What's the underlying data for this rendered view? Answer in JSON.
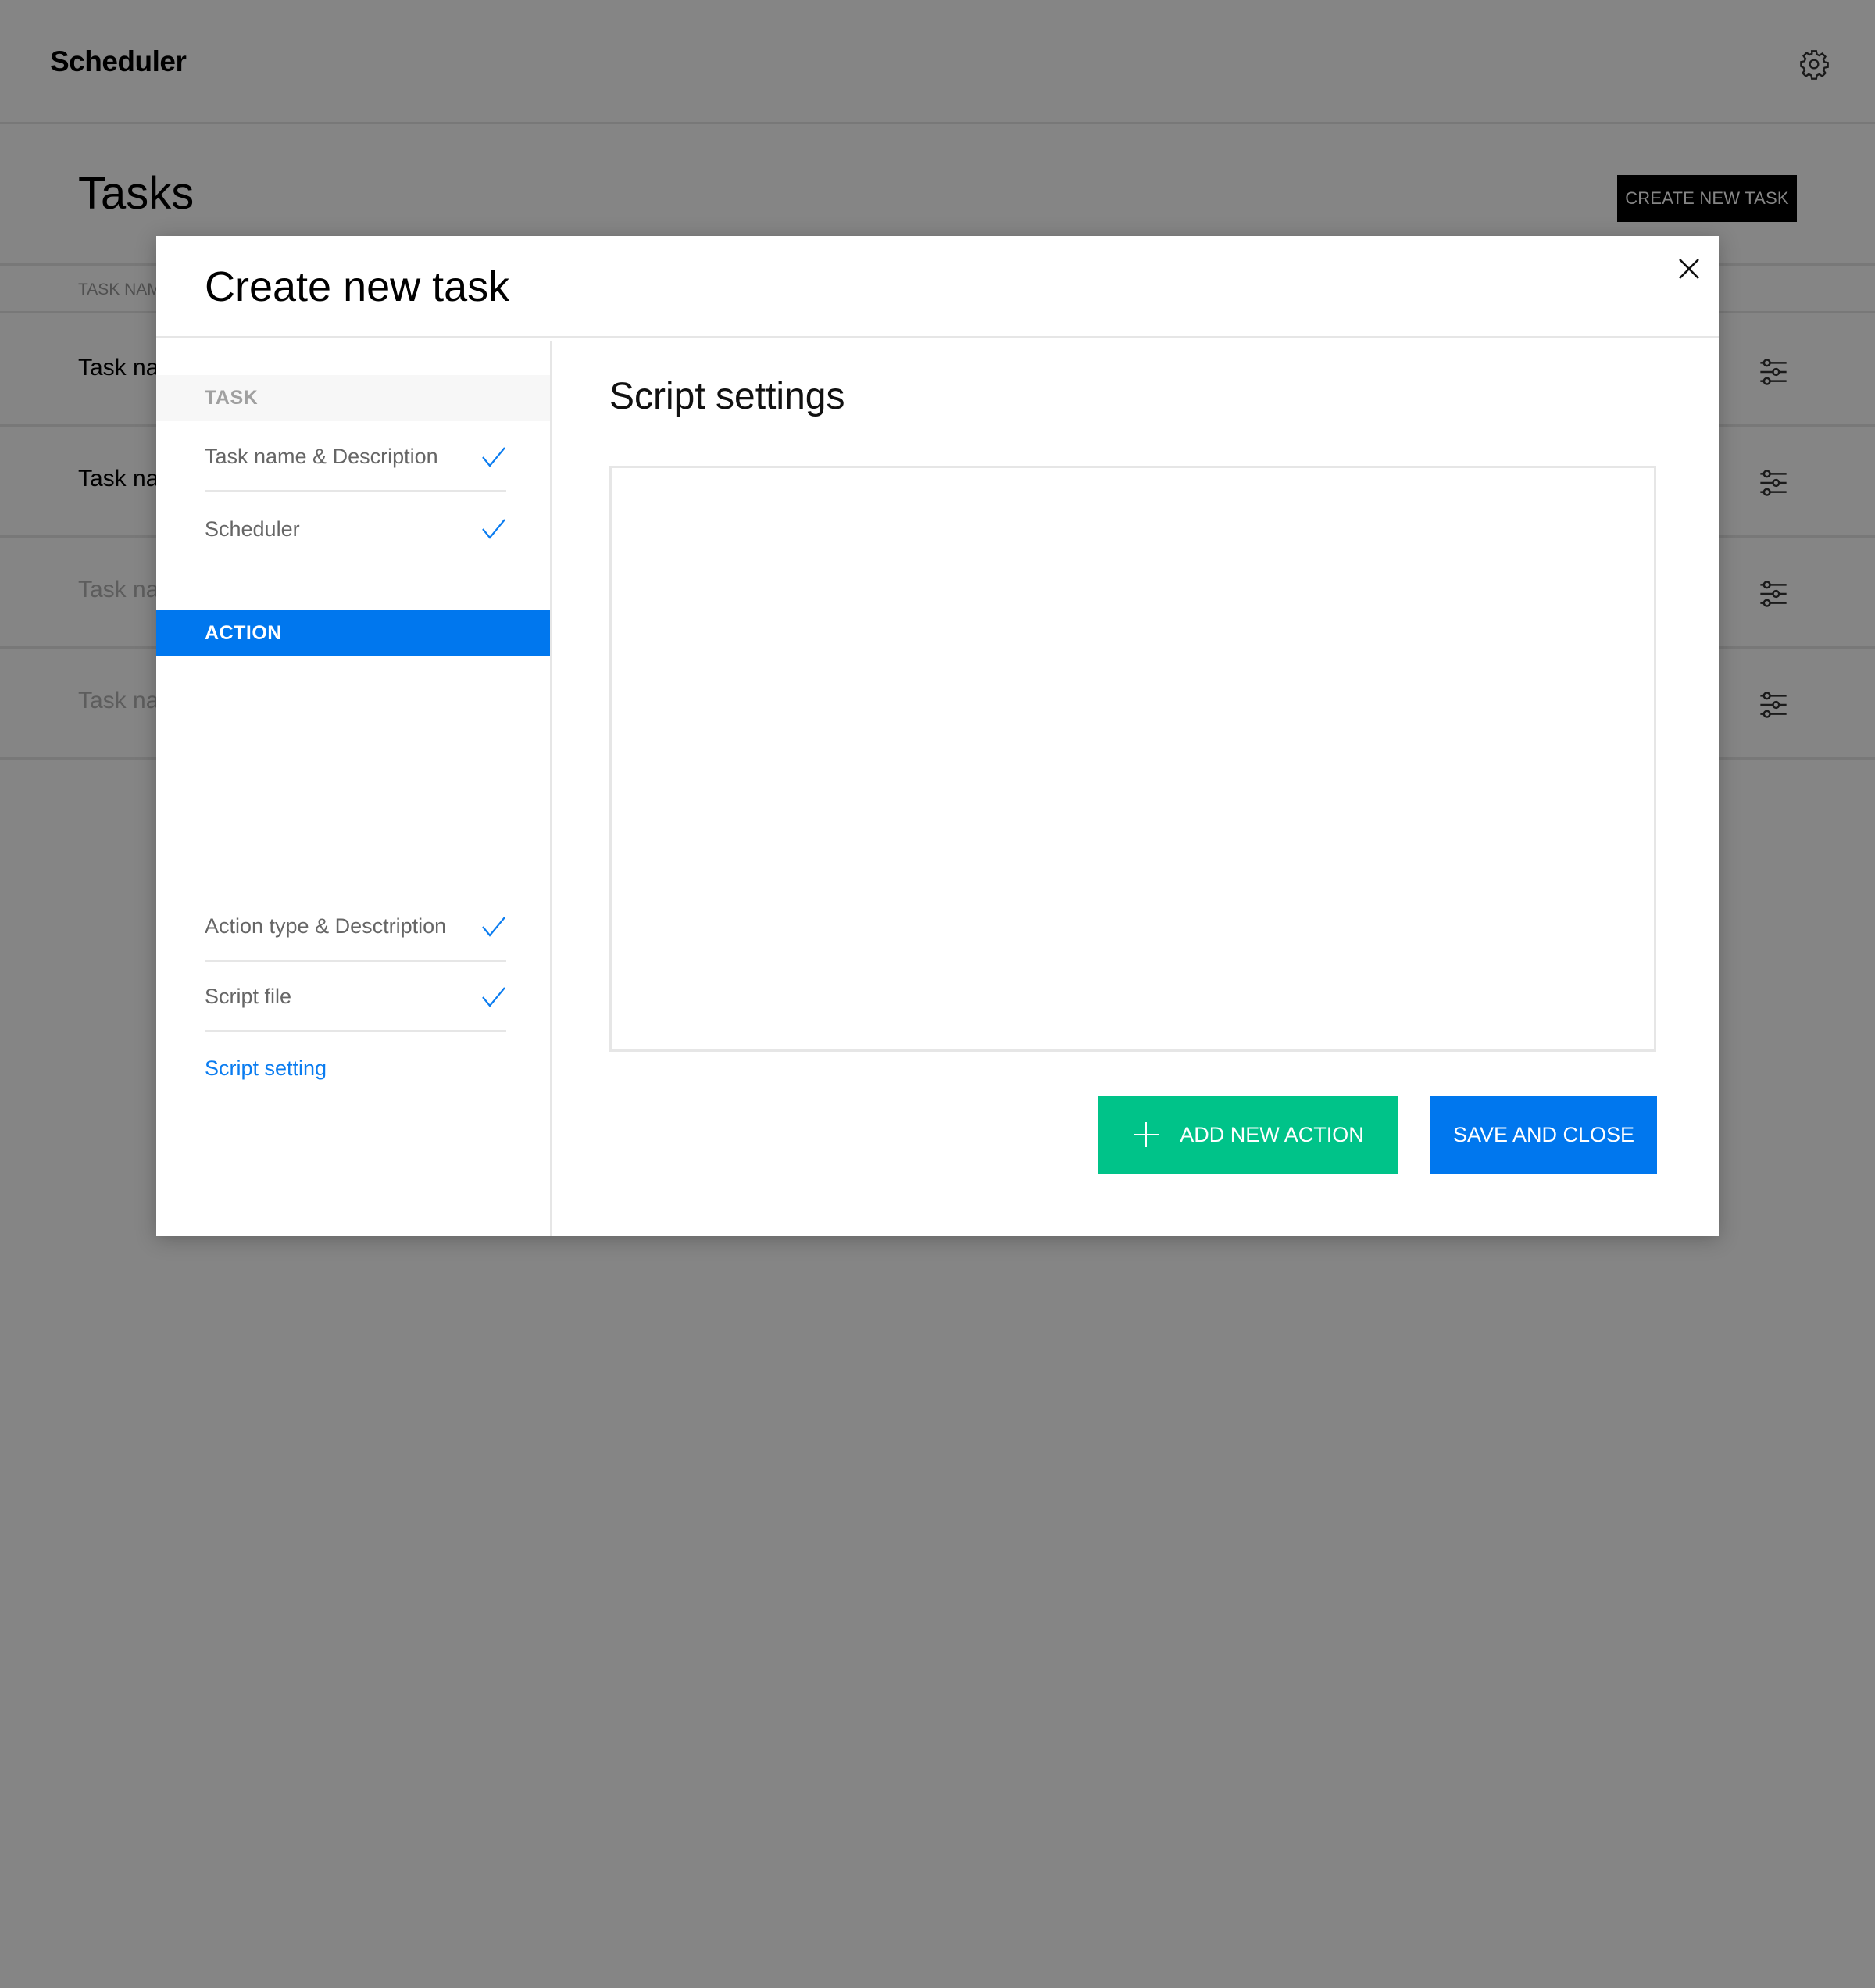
{
  "app": {
    "title": "Scheduler",
    "settings_icon": "gear-icon"
  },
  "page": {
    "title": "Tasks",
    "create_button": "CREATE NEW TASK",
    "table": {
      "columns": [
        "TASK NAME"
      ],
      "rows": [
        {
          "name": "Task name",
          "state": "active"
        },
        {
          "name": "Task name",
          "state": "active"
        },
        {
          "name": "Task name",
          "state": "disabled"
        },
        {
          "name": "Task name",
          "state": "disabled"
        }
      ],
      "row_icon": "sliders-icon"
    }
  },
  "modal": {
    "title": "Create new task",
    "close_icon": "close-icon",
    "sidebar": {
      "sections": [
        {
          "label": "TASK",
          "highlighted": false,
          "steps": [
            {
              "label": "Task name & Description",
              "completed": true
            },
            {
              "label": "Scheduler",
              "completed": true
            }
          ]
        },
        {
          "label": "ACTION",
          "highlighted": true,
          "steps": [
            {
              "label": "Action type & Desctription",
              "completed": true
            },
            {
              "label": "Script file",
              "completed": true
            },
            {
              "label": "Script setting",
              "completed": false,
              "current": true
            }
          ]
        }
      ]
    },
    "content": {
      "title": "Script settings",
      "script_value": "",
      "add_action_button": "ADD NEW ACTION",
      "save_button": "SAVE AND CLOSE"
    }
  },
  "colors": {
    "primary_blue": "#0077ee",
    "success_green": "#00c389",
    "overlay": "rgba(0,0,0,0.48)"
  }
}
